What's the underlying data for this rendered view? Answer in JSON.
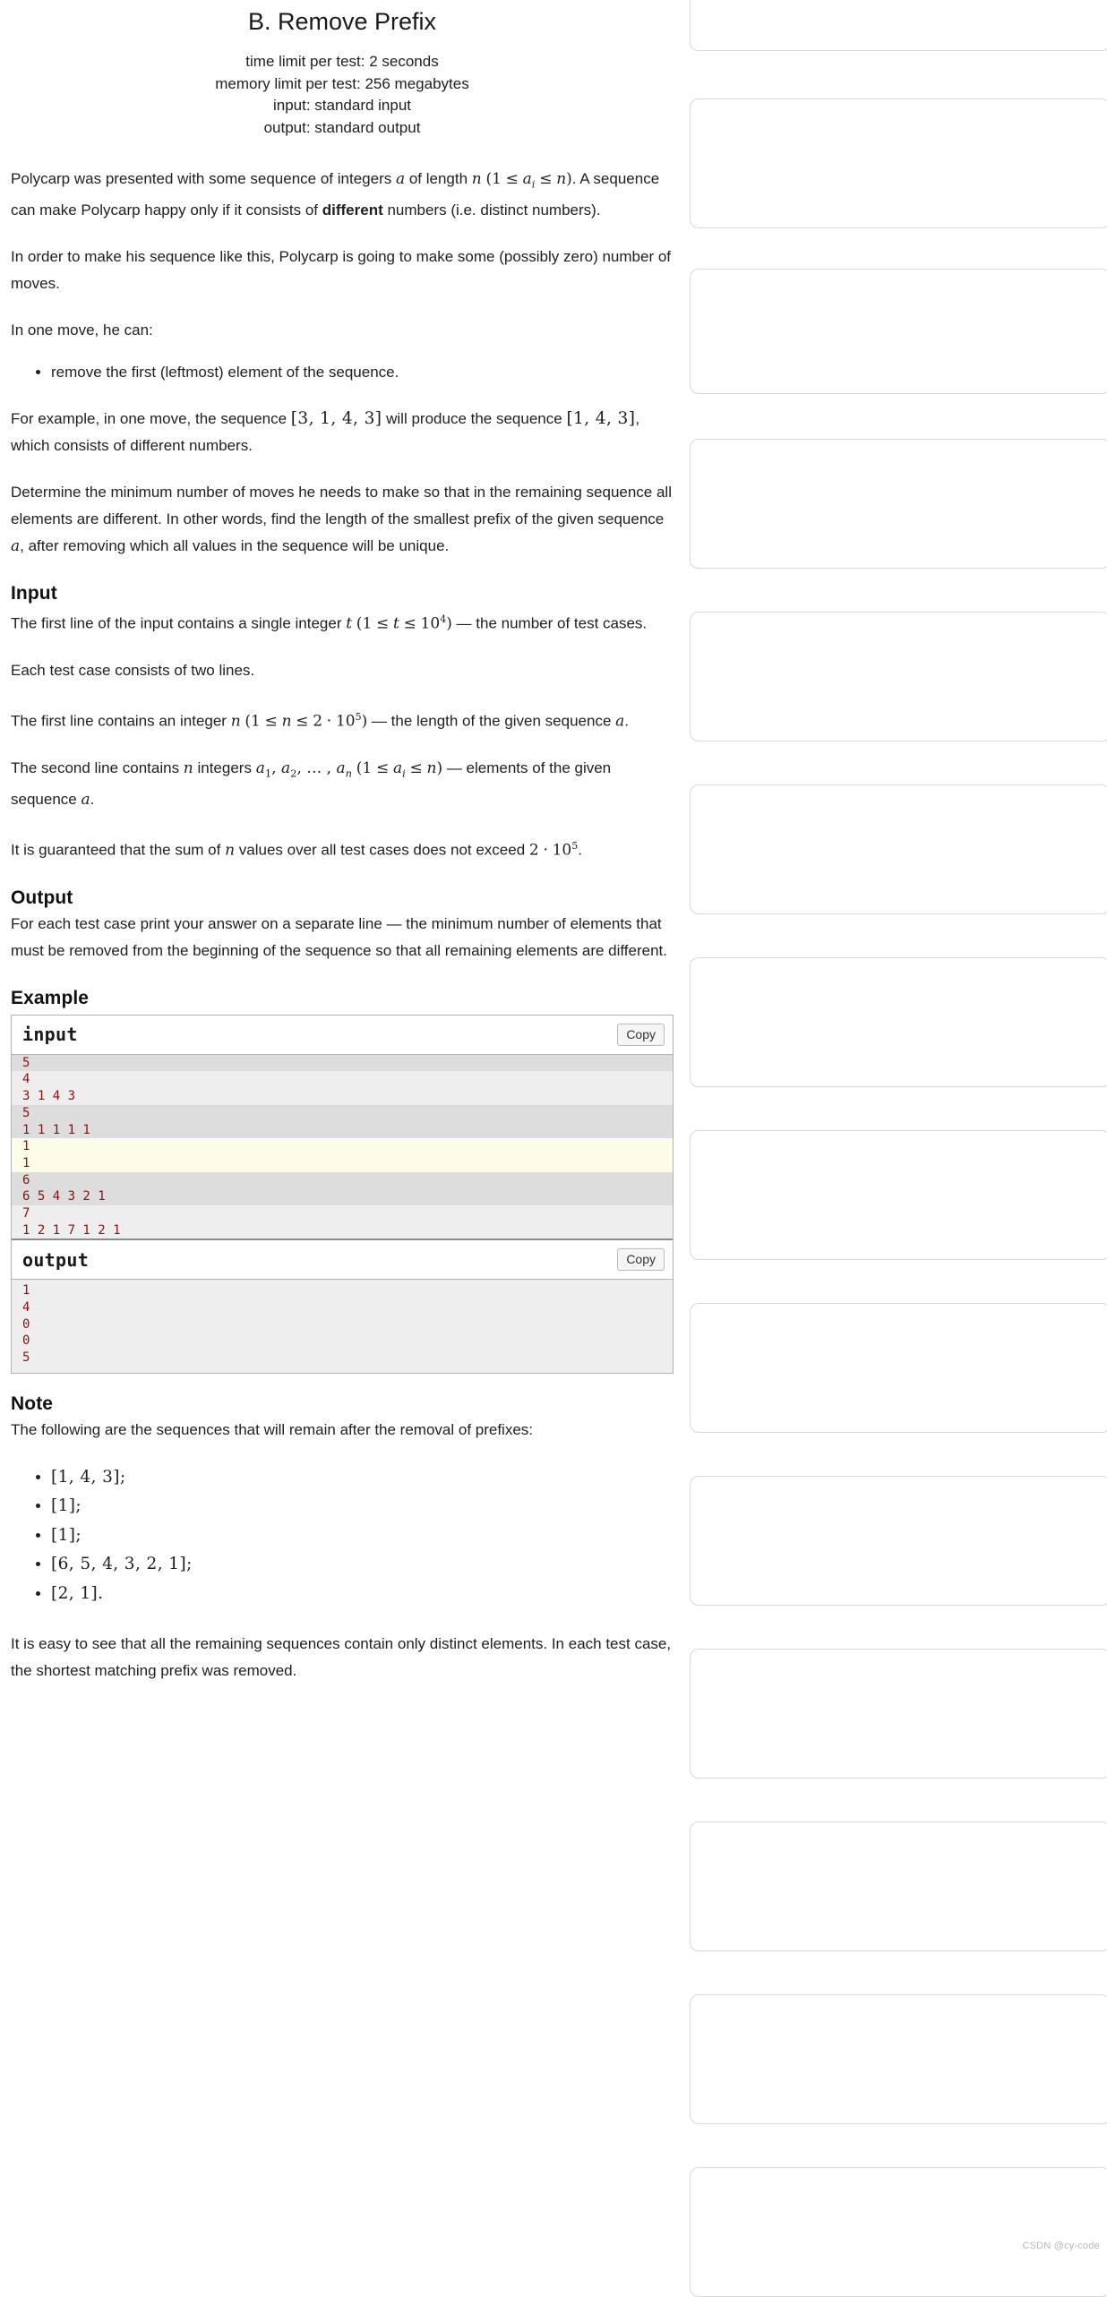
{
  "problem": {
    "title": "B. Remove Prefix",
    "limits": [
      "time limit per test: 2 seconds",
      "memory limit per test: 256 megabytes",
      "input: standard input",
      "output: standard output"
    ]
  },
  "statement": {
    "p1_a": "Polycarp was presented with some sequence of integers ",
    "p1_var_a": "a",
    "p1_b": " of length ",
    "p1_var_n": "n",
    "p1_paren_open": "(",
    "p1_one": "1",
    "p1_le1": "≤",
    "p1_ai": "a",
    "p1_ai_sub": "i",
    "p1_le2": "≤",
    "p1_n2": "n",
    "p1_paren_close": ")",
    "p1_c": ". A sequence can make Polycarp happy only if it consists of ",
    "p1_bold": "different",
    "p1_d": " numbers (i.e. distinct numbers).",
    "p2": "In order to make his sequence like this, Polycarp is going to make some (possibly zero) number of moves.",
    "p3": "In one move, he can:",
    "bullet1": "remove the first (leftmost) element of the sequence.",
    "p4_a": "For example, in one move, the sequence ",
    "p4_seq1": "[3, 1, 4, 3]",
    "p4_b": " will produce the sequence ",
    "p4_seq2": "[1, 4, 3]",
    "p4_c": ", which consists of different numbers.",
    "p5_a": "Determine the minimum number of moves he needs to make so that in the remaining sequence all elements are different. In other words, find the length of the smallest prefix of the given sequence ",
    "p5_var_a": "a",
    "p5_b": ", after removing which all values in the sequence will be unique."
  },
  "input_section": {
    "heading": "Input",
    "p1_a": "The first line of the input contains a single integer ",
    "p1_t": "t",
    "p1_open": "(",
    "p1_one": "1",
    "p1_le1": "≤",
    "p1_t2": "t",
    "p1_le2": "≤",
    "p1_ten": "10",
    "p1_exp": "4",
    "p1_close": ")",
    "p1_b": " — the number of test cases.",
    "p2": "Each test case consists of two lines.",
    "p3_a": "The first line contains an integer ",
    "p3_n": "n",
    "p3_open": "(",
    "p3_one": "1",
    "p3_le1": "≤",
    "p3_n2": "n",
    "p3_le2": "≤",
    "p3_two": "2",
    "p3_dot": "·",
    "p3_ten": "10",
    "p3_exp": "5",
    "p3_close": ")",
    "p3_b": " — the length of the given sequence ",
    "p3_a_var": "a",
    "p3_c": ".",
    "p4_a": "The second line contains ",
    "p4_n": "n",
    "p4_b": " integers ",
    "p4_a1": "a",
    "p4_a1sub": "1",
    "p4_comma1": ", ",
    "p4_a2": "a",
    "p4_a2sub": "2",
    "p4_comma2": ", … , ",
    "p4_an": "a",
    "p4_ansub": "n",
    "p4_open": "(",
    "p4_one": "1",
    "p4_le1": "≤",
    "p4_ai": "a",
    "p4_aisub": "i",
    "p4_le2": "≤",
    "p4_n2": "n",
    "p4_close": ")",
    "p4_c": " — elements of the given sequence ",
    "p4_a_var": "a",
    "p4_d": ".",
    "p5_a": "It is guaranteed that the sum of ",
    "p5_n": "n",
    "p5_b": " values over all test cases does not exceed ",
    "p5_two": "2",
    "p5_dot": "·",
    "p5_ten": "10",
    "p5_exp": "5",
    "p5_c": "."
  },
  "output_section": {
    "heading": "Output",
    "p1": "For each test case print your answer on a separate line — the minimum number of elements that must be removed from the beginning of the sequence so that all remaining elements are different."
  },
  "example": {
    "heading": "Example",
    "input_label": "input",
    "output_label": "output",
    "copy_label": "Copy",
    "input_lines": [
      {
        "text": "5",
        "tone": "tone-a"
      },
      {
        "text": "4",
        "tone": "tone-b"
      },
      {
        "text": "3 1 4 3",
        "tone": "tone-b"
      },
      {
        "text": "5",
        "tone": "tone-a"
      },
      {
        "text": "1 1 1 1 1",
        "tone": "tone-a"
      },
      {
        "text": "1",
        "tone": "tone-c"
      },
      {
        "text": "1",
        "tone": "tone-c"
      },
      {
        "text": "6",
        "tone": "tone-a"
      },
      {
        "text": "6 5 4 3 2 1",
        "tone": "tone-a"
      },
      {
        "text": "7",
        "tone": "tone-b"
      },
      {
        "text": "1 2 1 7 1 2 1",
        "tone": "tone-b"
      }
    ],
    "output_lines": [
      {
        "text": "1",
        "tone": "tone-b"
      },
      {
        "text": "4",
        "tone": "tone-b"
      },
      {
        "text": "0",
        "tone": "tone-b"
      },
      {
        "text": "0",
        "tone": "tone-b"
      },
      {
        "text": "5",
        "tone": "tone-b"
      }
    ]
  },
  "note_section": {
    "heading": "Note",
    "p1": "The following are the sequences that will remain after the removal of prefixes:",
    "items": [
      "[1, 4, 3];",
      "[1];",
      "[1];",
      "[6, 5, 4, 3, 2, 1];",
      "[2, 1]."
    ],
    "p2": "It is easy to see that all the remaining sequences contain only distinct elements. In each test case, the shortest matching prefix was removed."
  },
  "watermark": "CSDN @cy-code"
}
